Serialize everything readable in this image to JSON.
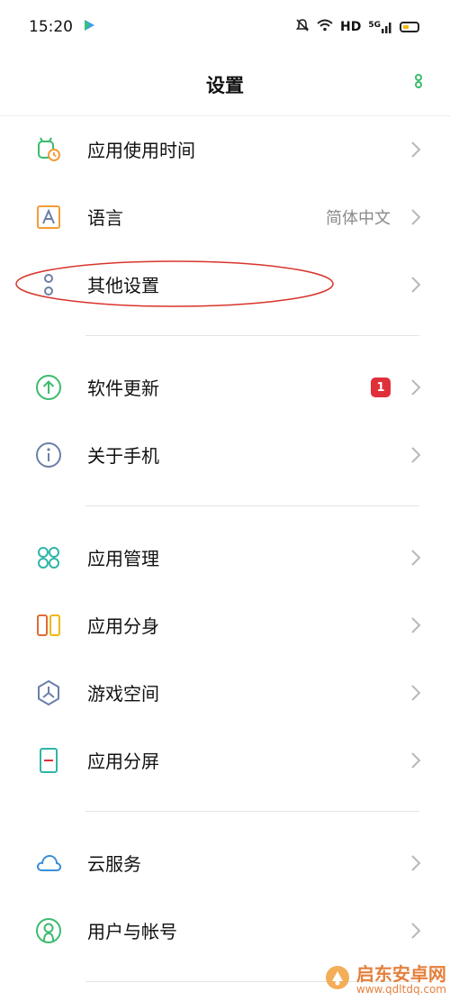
{
  "status_bar": {
    "time": "15:20",
    "network": "HD",
    "cell": "5G"
  },
  "header": {
    "title": "设置"
  },
  "items": [
    {
      "label": "应用使用时间",
      "value": "",
      "badge": "",
      "icon": "app-usage-time-icon"
    },
    {
      "label": "语言",
      "value": "简体中文",
      "badge": "",
      "icon": "language-icon"
    },
    {
      "label": "其他设置",
      "value": "",
      "badge": "",
      "icon": "other-settings-icon"
    },
    {
      "label": "软件更新",
      "value": "",
      "badge": "1",
      "icon": "software-update-icon"
    },
    {
      "label": "关于手机",
      "value": "",
      "badge": "",
      "icon": "about-phone-icon"
    },
    {
      "label": "应用管理",
      "value": "",
      "badge": "",
      "icon": "app-management-icon"
    },
    {
      "label": "应用分身",
      "value": "",
      "badge": "",
      "icon": "app-clone-icon"
    },
    {
      "label": "游戏空间",
      "value": "",
      "badge": "",
      "icon": "game-space-icon"
    },
    {
      "label": "应用分屏",
      "value": "",
      "badge": "",
      "icon": "split-screen-icon"
    },
    {
      "label": "云服务",
      "value": "",
      "badge": "",
      "icon": "cloud-service-icon"
    },
    {
      "label": "用户与帐号",
      "value": "",
      "badge": "",
      "icon": "user-account-icon"
    }
  ],
  "colors": {
    "accent_green": "#3dbb6e",
    "badge_red": "#e0303a",
    "annotation_red": "#d9342b",
    "orange": "#f29d38",
    "blue_gray": "#6b7fa8"
  },
  "watermark": {
    "name": "启东安卓网",
    "url": "www.qdltdq.com"
  }
}
